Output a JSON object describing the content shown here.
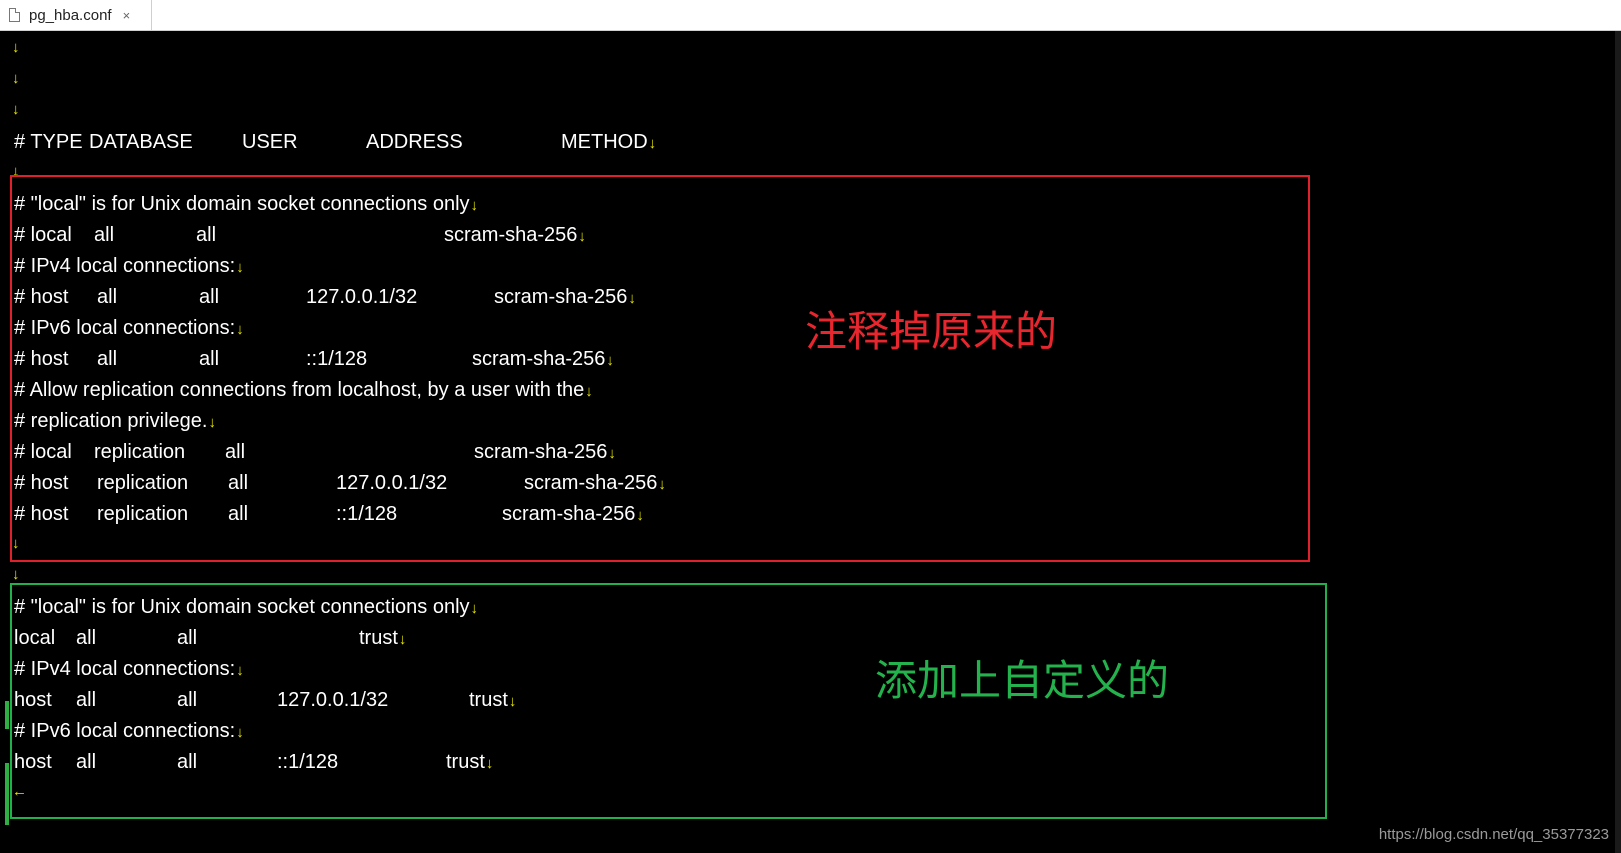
{
  "tab": {
    "filename": "pg_hba.conf",
    "close_glyph": "×",
    "icon": "file-icon"
  },
  "eol_glyph": "↓",
  "eof_glyph": "←",
  "header": [
    "# TYPE",
    "DATABASE",
    "USER",
    "ADDRESS",
    "METHOD"
  ],
  "original": {
    "comment_local": "# \"local\" is for Unix domain socket connections only",
    "local": [
      "# local",
      "all",
      "all",
      "scram-sha-256"
    ],
    "comment_ipv4": "# IPv4 local connections:",
    "host_v4": [
      "# host",
      "all",
      "all",
      "127.0.0.1/32",
      "scram-sha-256"
    ],
    "comment_ipv6": "# IPv6 local connections:",
    "host_v6": [
      "# host",
      "all",
      "all",
      "::1/128",
      "scram-sha-256"
    ],
    "comment_repl1": "# Allow replication connections from localhost, by a user with the",
    "comment_repl2": "# replication privilege.",
    "repl_local": [
      "# local",
      "replication",
      "all",
      "scram-sha-256"
    ],
    "repl_v4": [
      "# host",
      "replication",
      "all",
      "127.0.0.1/32",
      "scram-sha-256"
    ],
    "repl_v6": [
      "# host",
      "replication",
      "all",
      "::1/128",
      "scram-sha-256"
    ]
  },
  "custom": {
    "comment_local": "# \"local\" is for Unix domain socket connections only",
    "local": [
      "local",
      "all",
      "all",
      "trust"
    ],
    "comment_ipv4": "# IPv4 local connections:",
    "host_v4": [
      "host",
      "all",
      "all",
      "127.0.0.1/32",
      "trust"
    ],
    "comment_ipv6": "# IPv6 local connections:",
    "host_v6": [
      "host",
      "all",
      "all",
      "::1/128",
      "trust"
    ]
  },
  "annotations": {
    "commented_out": "注释掉原来的",
    "added_custom": "添加上自定义的"
  },
  "colors": {
    "annotation_red": "#e8262e",
    "annotation_green": "#23b24c",
    "eol_marker": "#e6e600",
    "background": "#000000",
    "text": "#ffffff"
  },
  "watermark": "https://blog.csdn.net/qq_35377323"
}
